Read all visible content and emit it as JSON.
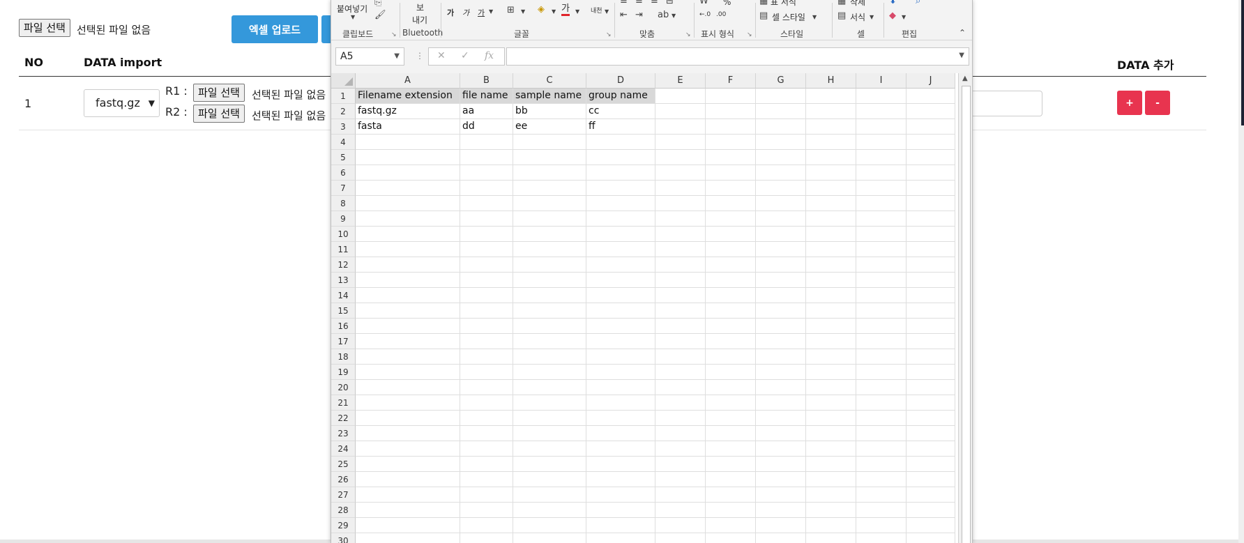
{
  "page": {
    "file_button_label": "파일 선택",
    "no_file_text": "선택된 파일 없음",
    "excel_upload_label": "엑셀 업로드",
    "headers": {
      "no": "NO",
      "data_import": "DATA import",
      "data_add": "DATA 추가"
    },
    "row": {
      "no": "1",
      "format": "fastq.gz",
      "r1_label": "R1 :",
      "r2_label": "R2 :",
      "r1_button": "파일 선택",
      "r1_status": "선택된 파일 없음",
      "r2_button": "파일 선택",
      "r2_status": "선택된 파일 없음",
      "add_label": "+",
      "remove_label": "-"
    }
  },
  "excel": {
    "ribbon": {
      "paste_label": "붙여넣기",
      "bluetooth_btn_top": "보",
      "bluetooth_btn_bottom": "내기",
      "groups": {
        "clipboard": "클립보드",
        "bluetooth": "Bluetooth",
        "font": "글꼴",
        "alignment": "맞춤",
        "number": "표시 형식",
        "styles": "스타일",
        "cells": "셀",
        "editing": "편집"
      },
      "font_buttons": [
        "가",
        "가",
        "가"
      ],
      "font_color_glyph": "가",
      "phonetic_glyph": "내천",
      "percent_glyph": "%",
      "dec_increase": "←.0",
      "dec_decrease": ".00",
      "format_table_label": "표 서식",
      "cell_style_label": "셀 스타일",
      "delete_label": "삭제",
      "format_label": "서식"
    },
    "name_box": "A5",
    "fx_label": "fx",
    "columns": [
      "A",
      "B",
      "C",
      "D",
      "E",
      "F",
      "G",
      "H",
      "I",
      "J"
    ],
    "rows": [
      "1",
      "2",
      "3",
      "4",
      "5",
      "6",
      "7",
      "8",
      "9",
      "10",
      "11",
      "12",
      "13",
      "14",
      "15",
      "16",
      "17",
      "18",
      "19",
      "20",
      "21",
      "22",
      "23",
      "24",
      "25",
      "26",
      "27",
      "28",
      "29",
      "30"
    ],
    "cells": [
      [
        "Filename extension",
        "file name",
        "sample name",
        "group name"
      ],
      [
        "fastq.gz",
        "aa",
        "bb",
        "cc"
      ],
      [
        "fasta",
        "dd",
        "ee",
        "ff"
      ]
    ]
  }
}
